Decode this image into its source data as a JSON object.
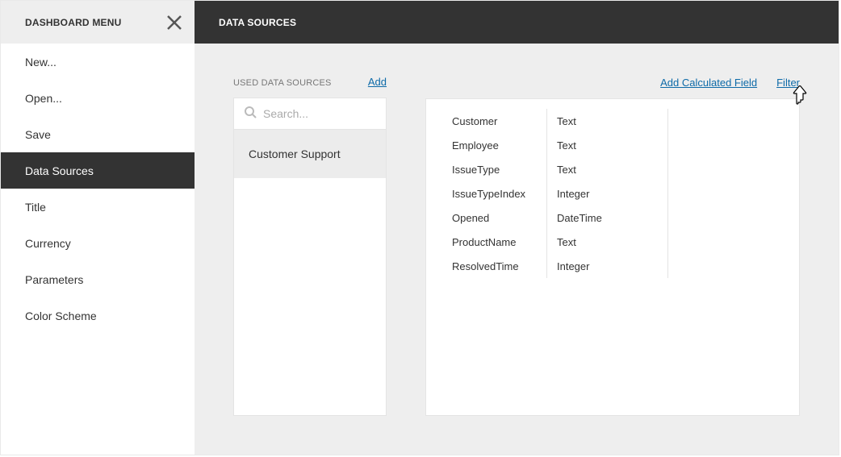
{
  "sidebar": {
    "title": "DASHBOARD MENU",
    "items": [
      {
        "label": "New...",
        "active": false
      },
      {
        "label": "Open...",
        "active": false
      },
      {
        "label": "Save",
        "active": false
      },
      {
        "label": "Data Sources",
        "active": true
      },
      {
        "label": "Title",
        "active": false
      },
      {
        "label": "Currency",
        "active": false
      },
      {
        "label": "Parameters",
        "active": false
      },
      {
        "label": "Color Scheme",
        "active": false
      }
    ]
  },
  "topbar": {
    "title": "DATA SOURCES"
  },
  "left": {
    "title": "USED DATA SOURCES",
    "add": "Add",
    "search_placeholder": "Search...",
    "items": [
      {
        "label": "Customer Support",
        "selected": true
      }
    ]
  },
  "right": {
    "add_calc": "Add Calculated Field",
    "filter": "Filter",
    "fields": [
      {
        "name": "Customer",
        "type": "Text"
      },
      {
        "name": "Employee",
        "type": "Text"
      },
      {
        "name": "IssueType",
        "type": "Text"
      },
      {
        "name": "IssueTypeIndex",
        "type": "Integer"
      },
      {
        "name": "Opened",
        "type": "DateTime"
      },
      {
        "name": "ProductName",
        "type": "Text"
      },
      {
        "name": "ResolvedTime",
        "type": "Integer"
      }
    ]
  }
}
